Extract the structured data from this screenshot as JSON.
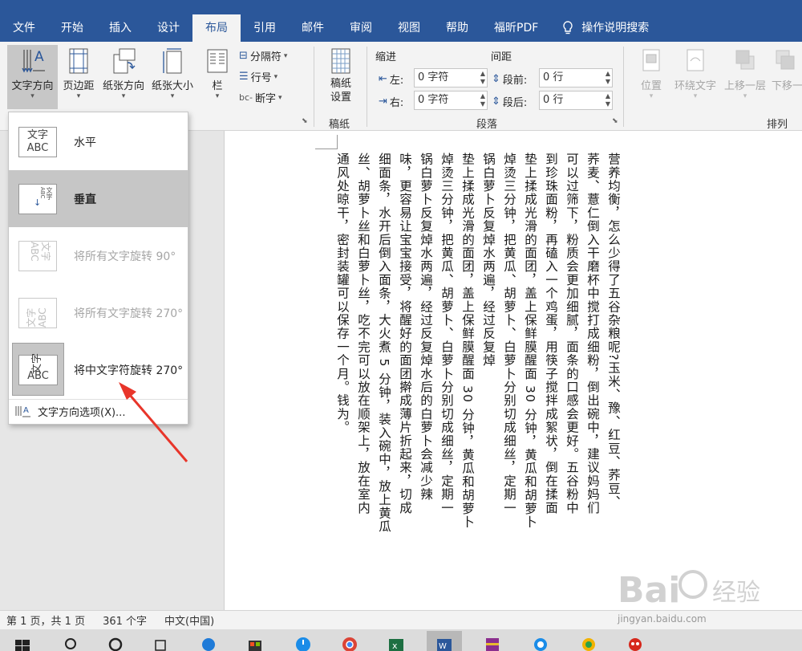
{
  "tabs": [
    "文件",
    "开始",
    "插入",
    "设计",
    "布局",
    "引用",
    "邮件",
    "审阅",
    "视图",
    "帮助",
    "福昕PDF"
  ],
  "active_tab": "布局",
  "tell_me": "操作说明搜索",
  "ribbon": {
    "page_setup": {
      "text_direction": "文字方向",
      "margins": "页边距",
      "orientation": "纸张方向",
      "size": "纸张大小",
      "columns": "栏",
      "breaks": "分隔符",
      "line_numbers": "行号",
      "hyphenation": "断字"
    },
    "manuscript": {
      "button": "稿纸\n设置",
      "button_line1": "稿纸",
      "button_line2": "设置",
      "group": "稿纸"
    },
    "paragraph": {
      "indent_title": "缩进",
      "spacing_title": "间距",
      "left_label": "左:",
      "left_value": "0 字符",
      "right_label": "右:",
      "right_value": "0 字符",
      "before_label": "段前:",
      "before_value": "0 行",
      "after_label": "段后:",
      "after_value": "0 行",
      "group": "段落"
    },
    "arrange": {
      "position": "位置",
      "wrap": "环绕文字",
      "bring_forward": "上移一层",
      "send_backward": "下移一",
      "group": "排列"
    }
  },
  "dropdown": {
    "options": [
      {
        "label": "水平",
        "thumb": "文字\nABC"
      },
      {
        "label": "垂直",
        "thumb": "文字ABC"
      },
      {
        "label": "将所有文字旋转 90°",
        "thumb": "文字ABC"
      },
      {
        "label": "将所有文字旋转 270°",
        "thumb": "文字ABC"
      },
      {
        "label": "将中文字符旋转 270°",
        "thumb": "文字ABC"
      }
    ],
    "thumb_top": "文字",
    "thumb_bottom": "ABC",
    "footer": "文字方向选项(X)..."
  },
  "document": {
    "columns": [
      "营养均衡，怎么少得了五谷杂粮呢?玉米、豫、红豆、荞豆、",
      "荞麦、薏仁倒入干磨杯中搅打成细粉，倒出碗中，建议妈妈们",
      "可以过筛下，粉质会更加细腻，面条的口感会更好。五谷粉中",
      "到珍珠面粉，再磕入一个鸡蛋，用筷子搅拌成絮状，倒在揉面",
      "垫上揉成光滑的面团，盖上保鲜膜醒面 30 分钟，黄瓜和胡萝卜",
      "焯烫三分钟，把黄瓜、胡萝卜、白萝卜分别切成细丝，定期一",
      "锅白萝卜反复焯水两遍，经过反复焯",
      "垫上揉成光滑的面团，盖上保鲜膜醒面 30 分钟，黄瓜和胡萝卜",
      "焯烫三分钟，把黄瓜、胡萝卜、白萝卜分别切成细丝，定期一",
      "锅白萝卜反复焯水两遍，经过反复焯水后的白萝卜会减少辣",
      "味，更容易让宝宝接受，将醒好的面团擀成薄片折起来，切成",
      "细面条，水开后倒入面条，大火煮 5 分钟，装入碗中，放上黄瓜",
      "丝、胡萝卜丝和白萝卜丝，吃不完可以放在顺架上，放在室内",
      "通风处晾干，密封装罐可以保存一个月。钱为。"
    ]
  },
  "status": {
    "page": "第 1 页，共 1 页",
    "words": "361 个字",
    "language": "中文(中国)"
  },
  "watermark": {
    "brand": "Bai",
    "brand2": "经验",
    "url": "jingyan.baidu.com"
  }
}
